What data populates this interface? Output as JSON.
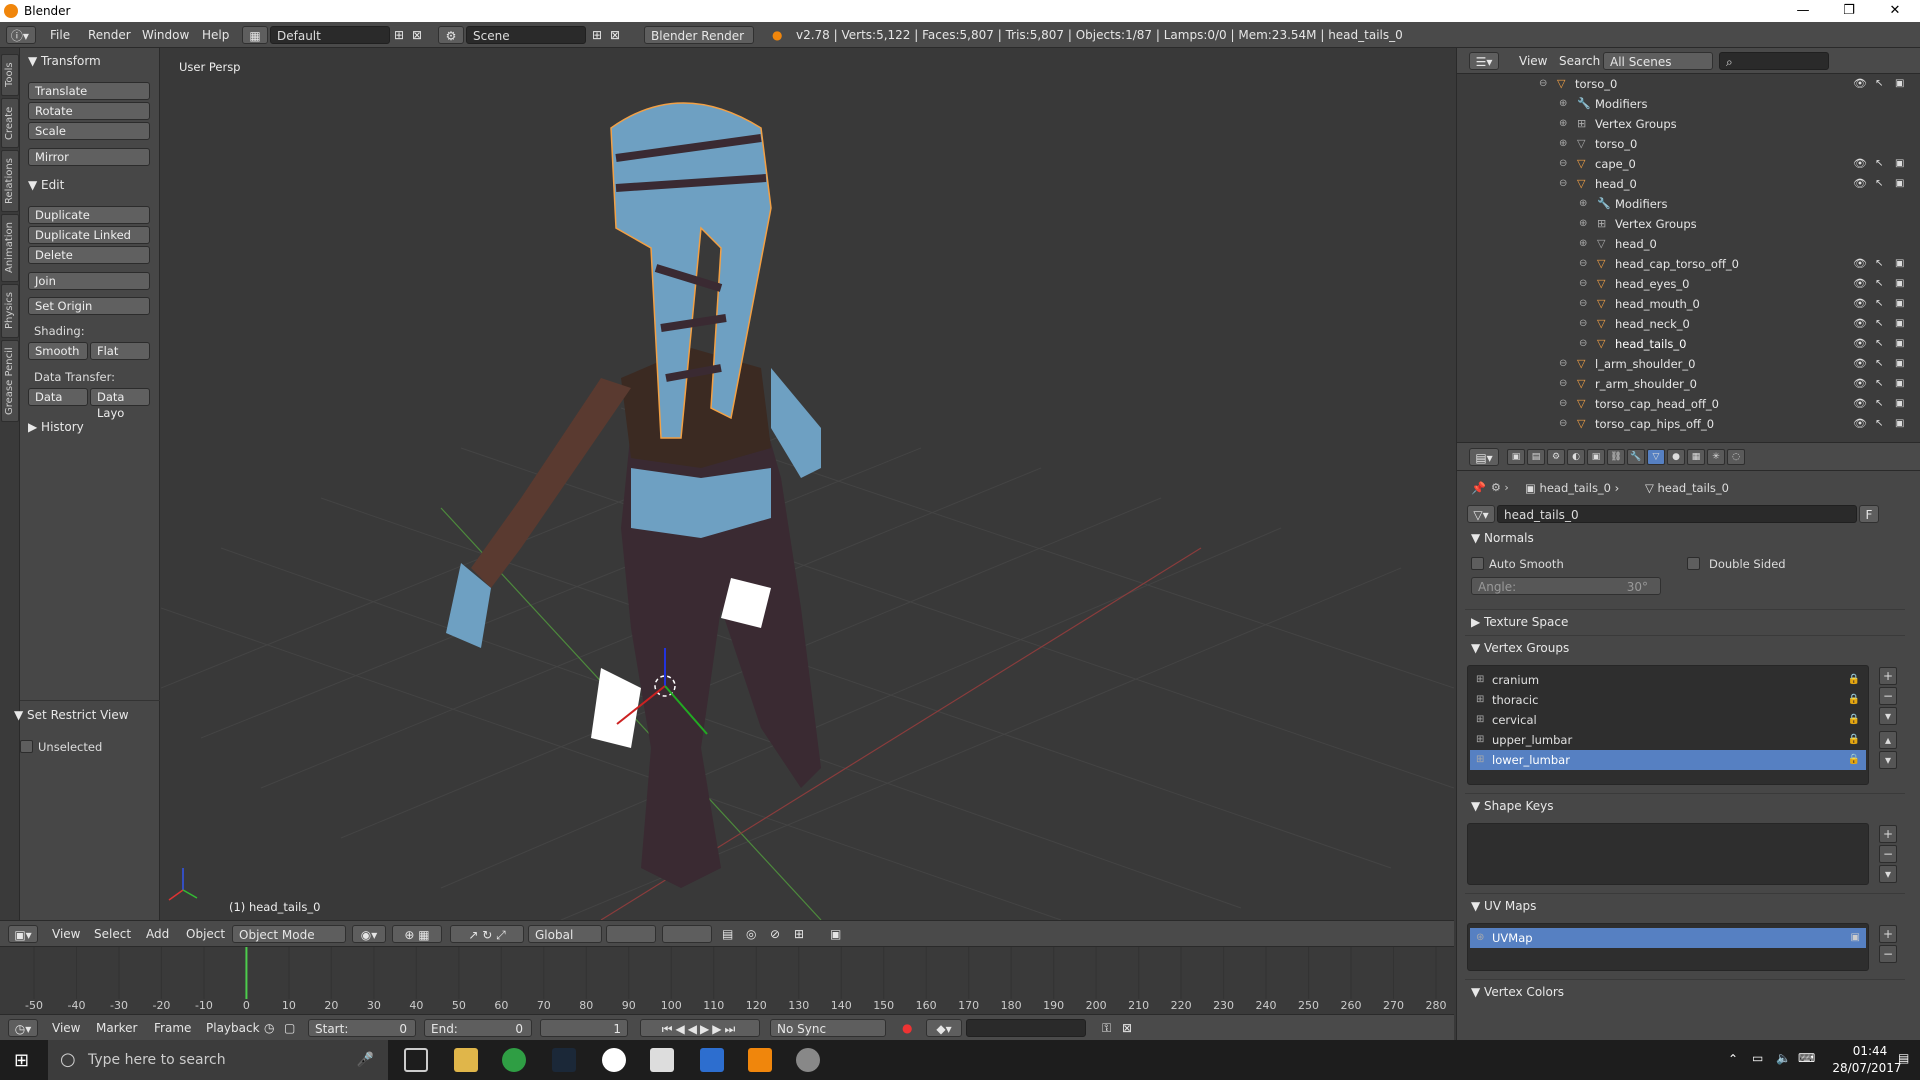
{
  "window": {
    "title": "Blender",
    "controls": [
      "—",
      "❐",
      "✕"
    ]
  },
  "info_header": {
    "menus": [
      "File",
      "Render",
      "Window",
      "Help"
    ],
    "layout": "Default",
    "scene": "Scene",
    "engine": "Blender Render",
    "stats": "v2.78 | Verts:5,122 | Faces:5,807 | Tris:5,807 | Objects:1/87 | Lamps:0/0 | Mem:23.54M | head_tails_0"
  },
  "tool_tabs": [
    "Tools",
    "Create",
    "Relations",
    "Animation",
    "Physics",
    "Grease Pencil"
  ],
  "tool_shelf": {
    "transform_header": "Transform",
    "translate": "Translate",
    "rotate": "Rotate",
    "scale": "Scale",
    "mirror": "Mirror",
    "edit_header": "Edit",
    "duplicate": "Duplicate",
    "duplicate_linked": "Duplicate Linked",
    "delete": "Delete",
    "join": "Join",
    "set_origin": "Set Origin",
    "shading_label": "Shading:",
    "smooth": "Smooth",
    "flat": "Flat",
    "data_transfer_label": "Data Transfer:",
    "data": "Data",
    "data_layo": "Data Layo",
    "history_header": "History",
    "restrict_header": "Set Restrict View",
    "unselected": "Unselected"
  },
  "viewport": {
    "label": "User Persp",
    "object_label": "(1) head_tails_0"
  },
  "viewport_header": {
    "menus": [
      "View",
      "Select",
      "Add",
      "Object"
    ],
    "mode": "Object Mode",
    "orientation": "Global"
  },
  "timeline": {
    "ticks": [
      -50,
      -40,
      -30,
      -20,
      -10,
      0,
      10,
      20,
      30,
      40,
      50,
      60,
      70,
      80,
      90,
      100,
      110,
      120,
      130,
      140,
      150,
      160,
      170,
      180,
      190,
      200,
      210,
      220,
      230,
      240,
      250,
      260,
      270,
      280
    ],
    "current_frame": 0,
    "menus": [
      "View",
      "Marker",
      "Frame",
      "Playback"
    ],
    "start_label": "Start:",
    "start_value": "0",
    "end_label": "End:",
    "end_value": "0",
    "frame_value": "1",
    "sync": "No Sync"
  },
  "outliner": {
    "menus": [
      "View",
      "Search"
    ],
    "scene_filter": "All Scenes",
    "rows": [
      {
        "name": "torso_0",
        "kind": "object",
        "indent": 0
      },
      {
        "name": "Modifiers",
        "kind": "modifiers",
        "indent": 1
      },
      {
        "name": "Vertex Groups",
        "kind": "vgroups",
        "indent": 1
      },
      {
        "name": "torso_0",
        "kind": "mesh",
        "indent": 1
      },
      {
        "name": "cape_0",
        "kind": "object",
        "indent": 1
      },
      {
        "name": "head_0",
        "kind": "object",
        "indent": 1
      },
      {
        "name": "Modifiers",
        "kind": "modifiers",
        "indent": 2
      },
      {
        "name": "Vertex Groups",
        "kind": "vgroups",
        "indent": 2
      },
      {
        "name": "head_0",
        "kind": "mesh",
        "indent": 2
      },
      {
        "name": "head_cap_torso_off_0",
        "kind": "object",
        "indent": 2
      },
      {
        "name": "head_eyes_0",
        "kind": "object",
        "indent": 2
      },
      {
        "name": "head_mouth_0",
        "kind": "object",
        "indent": 2
      },
      {
        "name": "head_neck_0",
        "kind": "object",
        "indent": 2
      },
      {
        "name": "head_tails_0",
        "kind": "object",
        "indent": 2,
        "selected": true
      },
      {
        "name": "l_arm_shoulder_0",
        "kind": "object",
        "indent": 1
      },
      {
        "name": "r_arm_shoulder_0",
        "kind": "object",
        "indent": 1
      },
      {
        "name": "torso_cap_head_off_0",
        "kind": "object",
        "indent": 1
      },
      {
        "name": "torso_cap_hips_off_0",
        "kind": "object",
        "indent": 1
      }
    ]
  },
  "properties": {
    "breadcrumb_object": "head_tails_0",
    "breadcrumb_mesh": "head_tails_0",
    "datablock_name": "head_tails_0",
    "fake_user": "F",
    "normals_header": "Normals",
    "auto_smooth": "Auto Smooth",
    "double_sided": "Double Sided",
    "angle_label": "Angle:",
    "angle_value": "30°",
    "texture_space_header": "Texture Space",
    "vertex_groups_header": "Vertex Groups",
    "vertex_groups": [
      "cranium",
      "thoracic",
      "cervical",
      "upper_lumbar",
      "lower_lumbar"
    ],
    "vertex_group_selected": "lower_lumbar",
    "shape_keys_header": "Shape Keys",
    "uv_maps_header": "UV Maps",
    "uv_maps": [
      "UVMap"
    ],
    "vertex_colors_header": "Vertex Colors"
  },
  "taskbar": {
    "search_placeholder": "Type here to search",
    "time": "01:44",
    "date": "28/07/2017"
  },
  "colors": {
    "accent": "#5680c2",
    "selection_outline": "#f2a045",
    "skin": "#6fa3c7"
  }
}
